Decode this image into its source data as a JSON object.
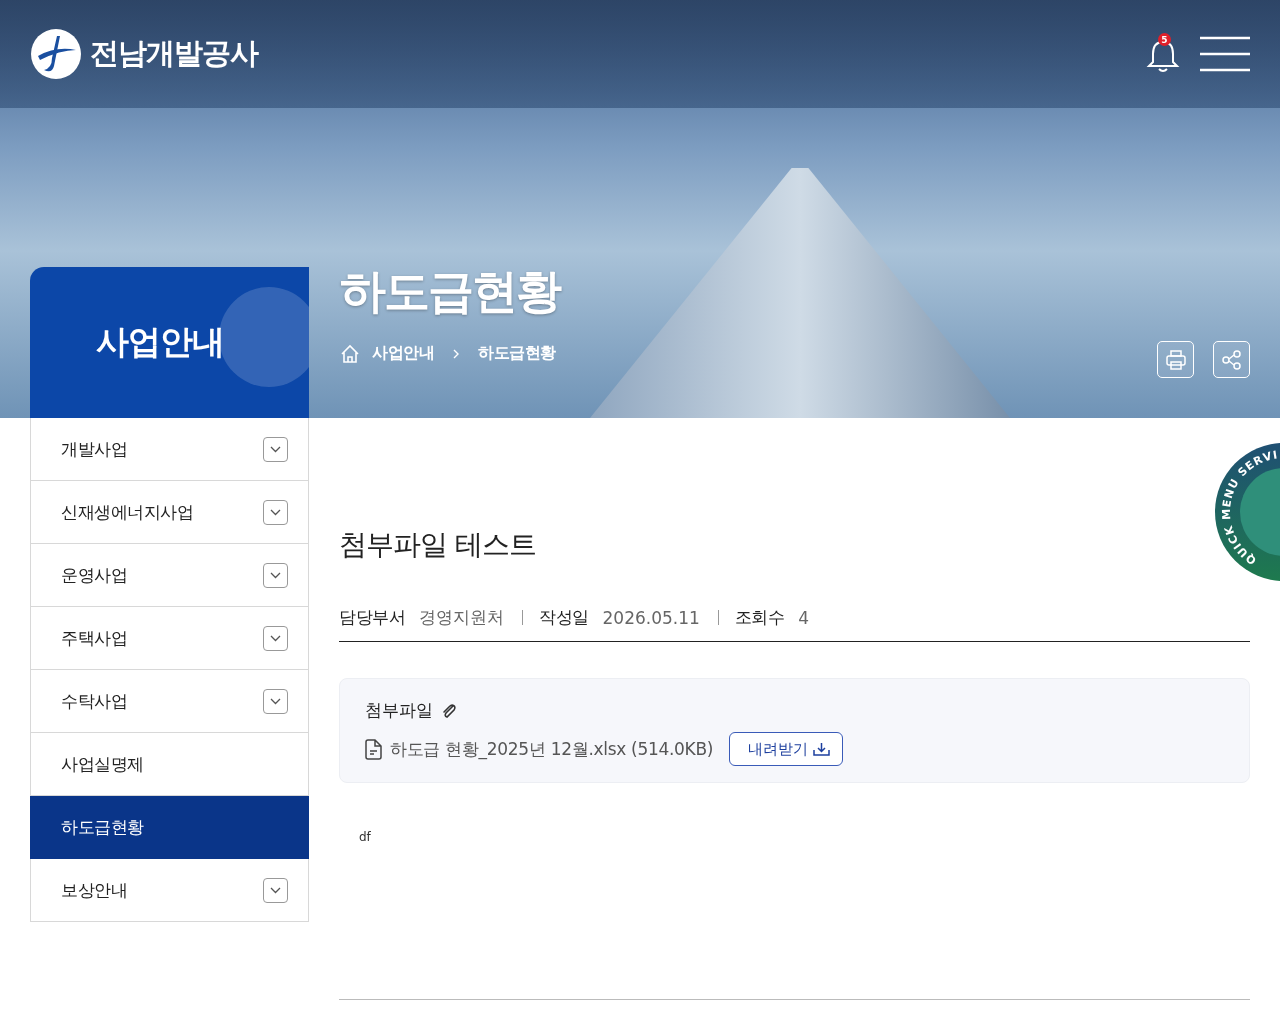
{
  "header": {
    "logo_text": "전남개발공사",
    "notification_count": "5"
  },
  "section_title": "사업안내",
  "page_title": "하도급현황",
  "breadcrumb": [
    "사업안내",
    "하도급현황"
  ],
  "sidebar": {
    "items": [
      {
        "label": "개발사업",
        "expandable": true,
        "selected": false
      },
      {
        "label": "신재생에너지사업",
        "expandable": true,
        "selected": false
      },
      {
        "label": "운영사업",
        "expandable": true,
        "selected": false
      },
      {
        "label": "주택사업",
        "expandable": true,
        "selected": false
      },
      {
        "label": "수탁사업",
        "expandable": true,
        "selected": false
      },
      {
        "label": "사업실명제",
        "expandable": false,
        "selected": false
      },
      {
        "label": "하도급현황",
        "expandable": false,
        "selected": true
      },
      {
        "label": "보상안내",
        "expandable": true,
        "selected": false
      }
    ]
  },
  "post": {
    "title": "첨부파일 테스트",
    "meta": [
      {
        "label": "담당부서",
        "value": "경영지원처"
      },
      {
        "label": "작성일",
        "value": "2026.05.11"
      },
      {
        "label": "조회수",
        "value": "4"
      }
    ],
    "attachments": {
      "heading": "첨부파일",
      "files": [
        {
          "name": "하도급 현황_2025년 12월.xlsx (514.0KB)",
          "button": "내려받기"
        }
      ]
    },
    "body": "df"
  },
  "quick_menu": {
    "label": "QUICK MENU SERVI"
  }
}
